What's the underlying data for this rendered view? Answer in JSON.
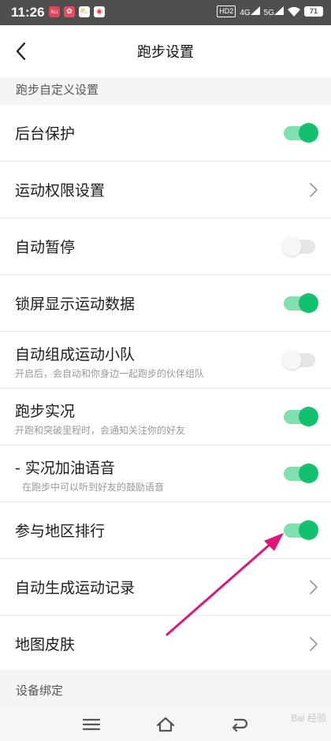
{
  "status_bar": {
    "time": "11:26",
    "app_icons": [
      {
        "name": "app-notification-1-icon",
        "color": "#e8415a",
        "glyph": "ku"
      },
      {
        "name": "app-notification-2-icon",
        "color": "#e84a64",
        "glyph": "✿"
      },
      {
        "name": "app-notification-3-icon",
        "color": "#ffffff",
        "glyph": "⛅"
      },
      {
        "name": "app-notification-4-icon",
        "color": "#e23b3b",
        "glyph": "◉"
      }
    ],
    "hd_label": "HD2",
    "net_4g": "4G",
    "net_5g": "5G",
    "battery": "71"
  },
  "header": {
    "title": "跑步设置"
  },
  "sections": {
    "custom": "跑步自定义设置",
    "device": "设备绑定"
  },
  "settings": [
    {
      "label": "后台保护",
      "type": "toggle",
      "on": true
    },
    {
      "label": "运动权限设置",
      "type": "link"
    },
    {
      "label": "自动暂停",
      "type": "toggle",
      "on": false
    },
    {
      "label": "锁屏显示运动数据",
      "type": "toggle",
      "on": true
    },
    {
      "label": "自动组成运动小队",
      "desc": "开启后，会自动和你身边一起跑步的伙伴组队",
      "type": "toggle",
      "on": false
    },
    {
      "label": "跑步实况",
      "desc": "开跑和突破里程时，会通知关注你的好友",
      "type": "toggle",
      "on": true
    },
    {
      "label": "- 实况加油语音",
      "desc": "在跑步中可以听到好友的鼓励语音",
      "type": "toggle",
      "on": true
    },
    {
      "label": "参与地区排行",
      "type": "toggle",
      "on": true
    },
    {
      "label": "自动生成运动记录",
      "type": "link"
    },
    {
      "label": "地图皮肤",
      "type": "link"
    }
  ],
  "watermark": "Bai 经验",
  "colors": {
    "toggle_on_knob": "#12c06f",
    "toggle_on_track": "#7ee0b3",
    "annotation_arrow": "#e0157a"
  }
}
